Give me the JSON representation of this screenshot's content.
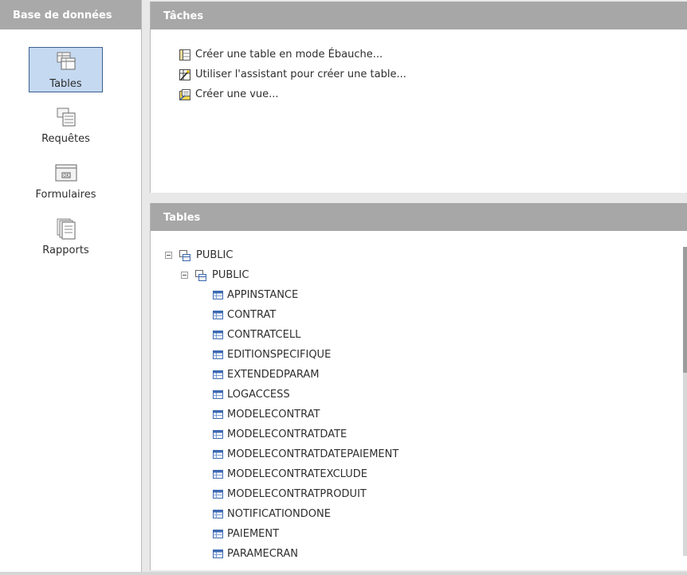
{
  "left_pane": {
    "title": "Base de données",
    "items": [
      {
        "label": "Tables",
        "icon": "tables-icon",
        "selected": true
      },
      {
        "label": "Requêtes",
        "icon": "queries-icon",
        "selected": false
      },
      {
        "label": "Formulaires",
        "icon": "forms-icon",
        "selected": false
      },
      {
        "label": "Rapports",
        "icon": "reports-icon",
        "selected": false
      }
    ]
  },
  "tasks": {
    "title": "Tâches",
    "items": [
      {
        "label": "Créer une table en mode Ébauche...",
        "icon": "table-design-icon"
      },
      {
        "label": "Utiliser l'assistant pour créer une table...",
        "icon": "table-wizard-icon"
      },
      {
        "label": "Créer une vue...",
        "icon": "create-view-icon"
      }
    ]
  },
  "tables": {
    "title": "Tables",
    "root": "PUBLIC",
    "schema": "PUBLIC",
    "items": [
      "APPINSTANCE",
      "CONTRAT",
      "CONTRATCELL",
      "EDITIONSPECIFIQUE",
      "EXTENDEDPARAM",
      "LOGACCESS",
      "MODELECONTRAT",
      "MODELECONTRATDATE",
      "MODELECONTRATDATEPAIEMENT",
      "MODELECONTRATEXCLUDE",
      "MODELECONTRATPRODUIT",
      "NOTIFICATIONDONE",
      "PAIEMENT",
      "PARAMECRAN"
    ]
  },
  "colors": {
    "header_bg": "#a7a7a7",
    "selection_bg": "#c5d9f1",
    "selection_border": "#3b5f8f"
  }
}
